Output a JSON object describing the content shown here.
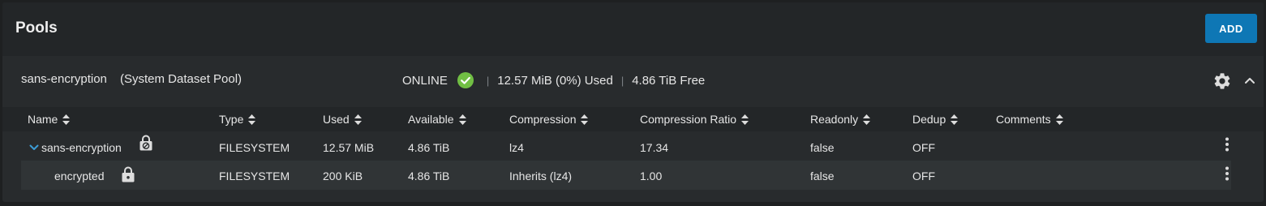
{
  "header": {
    "title": "Pools",
    "add_label": "ADD"
  },
  "pool": {
    "name": "sans-encryption",
    "description": "(System Dataset Pool)",
    "status": "ONLINE",
    "used": "12.57 MiB (0%) Used",
    "free": "4.86 TiB Free",
    "status_color": "#71bf44"
  },
  "columns": {
    "name": "Name",
    "type": "Type",
    "used": "Used",
    "available": "Available",
    "compression": "Compression",
    "compression_ratio": "Compression Ratio",
    "readonly": "Readonly",
    "dedup": "Dedup",
    "comments": "Comments"
  },
  "rows": [
    {
      "name": "sans-encryption",
      "type": "FILESYSTEM",
      "used": "12.57 MiB",
      "available": "4.86 TiB",
      "compression": "lz4",
      "compression_ratio": "17.34",
      "readonly": "false",
      "dedup": "OFF",
      "comments": "",
      "icon": "unlocked-disabled-lock-icon"
    },
    {
      "name": "encrypted",
      "type": "FILESYSTEM",
      "used": "200 KiB",
      "available": "4.86 TiB",
      "compression": "Inherits (lz4)",
      "compression_ratio": "1.00",
      "readonly": "false",
      "dedup": "OFF",
      "comments": "",
      "icon": "lock-icon"
    }
  ],
  "colors": {
    "accent": "#0e77b5",
    "ok": "#71bf44",
    "expand_chevron": "#3c9cd6"
  }
}
